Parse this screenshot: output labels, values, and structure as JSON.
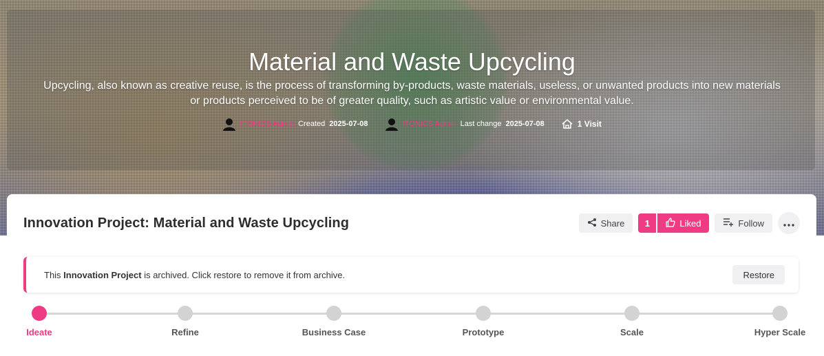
{
  "hero": {
    "title": "Material and Waste Upcycling",
    "description": "Upcycling, also known as creative reuse, is the process of transforming by-products, waste materials, useless, or unwanted products into new materials or products perceived to be of greater quality, such as artistic value or environmental value.",
    "created_by": "ITONICS Admin",
    "created_label": "Created",
    "created_date": "2025-07-08",
    "changed_by": "ITONICS Admin",
    "changed_label": "Last change",
    "changed_date": "2025-07-08",
    "visits": "1 Visit"
  },
  "header": {
    "title": "Innovation Project: Material and Waste Upcycling",
    "share_label": "Share",
    "like_count": "1",
    "liked_label": "Liked",
    "follow_label": "Follow"
  },
  "archive": {
    "text_prefix": "This ",
    "text_bold": "Innovation Project",
    "text_suffix": " is archived. Click restore to remove it from archive.",
    "restore_label": "Restore"
  },
  "stages": [
    {
      "label": "Ideate",
      "active": true
    },
    {
      "label": "Refine",
      "active": false
    },
    {
      "label": "Business Case",
      "active": false
    },
    {
      "label": "Prototype",
      "active": false
    },
    {
      "label": "Scale",
      "active": false
    },
    {
      "label": "Hyper Scale",
      "active": false
    }
  ],
  "colors": {
    "accent": "#ef3b83",
    "button_bg": "#f0f0f2",
    "inactive_stage": "#d3d3d3"
  },
  "icons": {
    "share": "share-icon",
    "like": "thumbs-up-icon",
    "follow": "follow-list-icon",
    "more": "more-dots-icon",
    "visits": "house-icon",
    "avatar": "user-avatar-icon"
  }
}
